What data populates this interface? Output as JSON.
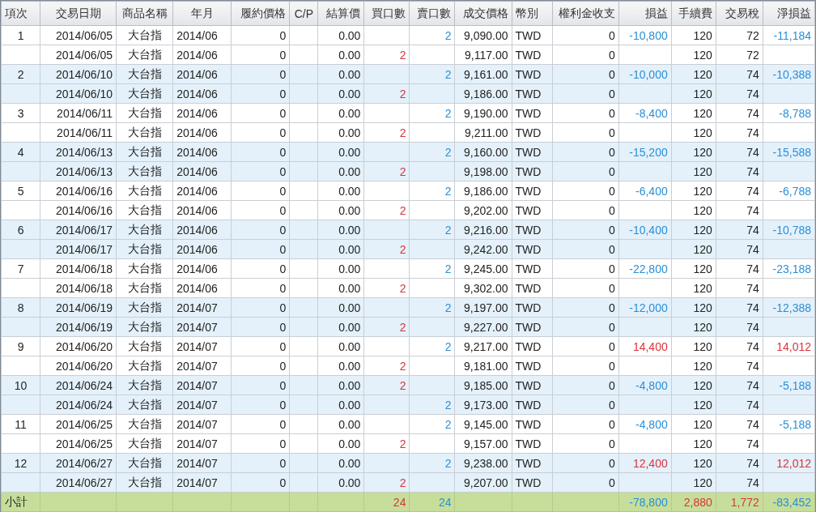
{
  "table": {
    "columns": [
      "項次",
      "交易日期",
      "商品名稱",
      "年月",
      "履約價格",
      "C/P",
      "結算價",
      "買口數",
      "賣口數",
      "成交價格",
      "幣別",
      "權利金收支",
      "損益",
      "手續費",
      "交易稅",
      "淨損益"
    ],
    "rows": [
      {
        "no": "1",
        "date": "2014/06/05",
        "product": "大台指",
        "month": "2014/06",
        "strike": "0",
        "settle": "0.00",
        "sell": "2",
        "price": "9,090.00",
        "currency": "TWD",
        "premium": "0",
        "pnl": "-10,800",
        "fee": "120",
        "tax": "72",
        "net": "-11,184",
        "gain": false
      },
      {
        "date": "2014/06/05",
        "product": "大台指",
        "month": "2014/06",
        "strike": "0",
        "settle": "0.00",
        "buy": "2",
        "price": "9,117.00",
        "currency": "TWD",
        "premium": "0",
        "fee": "120",
        "tax": "72"
      },
      {
        "no": "2",
        "date": "2014/06/10",
        "product": "大台指",
        "month": "2014/06",
        "strike": "0",
        "settle": "0.00",
        "sell": "2",
        "price": "9,161.00",
        "currency": "TWD",
        "premium": "0",
        "pnl": "-10,000",
        "fee": "120",
        "tax": "74",
        "net": "-10,388",
        "gain": false
      },
      {
        "date": "2014/06/10",
        "product": "大台指",
        "month": "2014/06",
        "strike": "0",
        "settle": "0.00",
        "buy": "2",
        "price": "9,186.00",
        "currency": "TWD",
        "premium": "0",
        "fee": "120",
        "tax": "74"
      },
      {
        "no": "3",
        "date": "2014/06/11",
        "product": "大台指",
        "month": "2014/06",
        "strike": "0",
        "settle": "0.00",
        "sell": "2",
        "price": "9,190.00",
        "currency": "TWD",
        "premium": "0",
        "pnl": "-8,400",
        "fee": "120",
        "tax": "74",
        "net": "-8,788",
        "gain": false
      },
      {
        "date": "2014/06/11",
        "product": "大台指",
        "month": "2014/06",
        "strike": "0",
        "settle": "0.00",
        "buy": "2",
        "price": "9,211.00",
        "currency": "TWD",
        "premium": "0",
        "fee": "120",
        "tax": "74"
      },
      {
        "no": "4",
        "date": "2014/06/13",
        "product": "大台指",
        "month": "2014/06",
        "strike": "0",
        "settle": "0.00",
        "sell": "2",
        "price": "9,160.00",
        "currency": "TWD",
        "premium": "0",
        "pnl": "-15,200",
        "fee": "120",
        "tax": "74",
        "net": "-15,588",
        "gain": false
      },
      {
        "date": "2014/06/13",
        "product": "大台指",
        "month": "2014/06",
        "strike": "0",
        "settle": "0.00",
        "buy": "2",
        "price": "9,198.00",
        "currency": "TWD",
        "premium": "0",
        "fee": "120",
        "tax": "74"
      },
      {
        "no": "5",
        "date": "2014/06/16",
        "product": "大台指",
        "month": "2014/06",
        "strike": "0",
        "settle": "0.00",
        "sell": "2",
        "price": "9,186.00",
        "currency": "TWD",
        "premium": "0",
        "pnl": "-6,400",
        "fee": "120",
        "tax": "74",
        "net": "-6,788",
        "gain": false
      },
      {
        "date": "2014/06/16",
        "product": "大台指",
        "month": "2014/06",
        "strike": "0",
        "settle": "0.00",
        "buy": "2",
        "price": "9,202.00",
        "currency": "TWD",
        "premium": "0",
        "fee": "120",
        "tax": "74"
      },
      {
        "no": "6",
        "date": "2014/06/17",
        "product": "大台指",
        "month": "2014/06",
        "strike": "0",
        "settle": "0.00",
        "sell": "2",
        "price": "9,216.00",
        "currency": "TWD",
        "premium": "0",
        "pnl": "-10,400",
        "fee": "120",
        "tax": "74",
        "net": "-10,788",
        "gain": false
      },
      {
        "date": "2014/06/17",
        "product": "大台指",
        "month": "2014/06",
        "strike": "0",
        "settle": "0.00",
        "buy": "2",
        "price": "9,242.00",
        "currency": "TWD",
        "premium": "0",
        "fee": "120",
        "tax": "74"
      },
      {
        "no": "7",
        "date": "2014/06/18",
        "product": "大台指",
        "month": "2014/06",
        "strike": "0",
        "settle": "0.00",
        "sell": "2",
        "price": "9,245.00",
        "currency": "TWD",
        "premium": "0",
        "pnl": "-22,800",
        "fee": "120",
        "tax": "74",
        "net": "-23,188",
        "gain": false
      },
      {
        "date": "2014/06/18",
        "product": "大台指",
        "month": "2014/06",
        "strike": "0",
        "settle": "0.00",
        "buy": "2",
        "price": "9,302.00",
        "currency": "TWD",
        "premium": "0",
        "fee": "120",
        "tax": "74"
      },
      {
        "no": "8",
        "date": "2014/06/19",
        "product": "大台指",
        "month": "2014/07",
        "strike": "0",
        "settle": "0.00",
        "sell": "2",
        "price": "9,197.00",
        "currency": "TWD",
        "premium": "0",
        "pnl": "-12,000",
        "fee": "120",
        "tax": "74",
        "net": "-12,388",
        "gain": false
      },
      {
        "date": "2014/06/19",
        "product": "大台指",
        "month": "2014/07",
        "strike": "0",
        "settle": "0.00",
        "buy": "2",
        "price": "9,227.00",
        "currency": "TWD",
        "premium": "0",
        "fee": "120",
        "tax": "74"
      },
      {
        "no": "9",
        "date": "2014/06/20",
        "product": "大台指",
        "month": "2014/07",
        "strike": "0",
        "settle": "0.00",
        "sell": "2",
        "price": "9,217.00",
        "currency": "TWD",
        "premium": "0",
        "pnl": "14,400",
        "fee": "120",
        "tax": "74",
        "net": "14,012",
        "gain": true
      },
      {
        "date": "2014/06/20",
        "product": "大台指",
        "month": "2014/07",
        "strike": "0",
        "settle": "0.00",
        "buy": "2",
        "price": "9,181.00",
        "currency": "TWD",
        "premium": "0",
        "fee": "120",
        "tax": "74"
      },
      {
        "no": "10",
        "date": "2014/06/24",
        "product": "大台指",
        "month": "2014/07",
        "strike": "0",
        "settle": "0.00",
        "buy": "2",
        "price": "9,185.00",
        "currency": "TWD",
        "premium": "0",
        "pnl": "-4,800",
        "fee": "120",
        "tax": "74",
        "net": "-5,188",
        "gain": false
      },
      {
        "date": "2014/06/24",
        "product": "大台指",
        "month": "2014/07",
        "strike": "0",
        "settle": "0.00",
        "sell": "2",
        "price": "9,173.00",
        "currency": "TWD",
        "premium": "0",
        "fee": "120",
        "tax": "74"
      },
      {
        "no": "11",
        "date": "2014/06/25",
        "product": "大台指",
        "month": "2014/07",
        "strike": "0",
        "settle": "0.00",
        "sell": "2",
        "price": "9,145.00",
        "currency": "TWD",
        "premium": "0",
        "pnl": "-4,800",
        "fee": "120",
        "tax": "74",
        "net": "-5,188",
        "gain": false
      },
      {
        "date": "2014/06/25",
        "product": "大台指",
        "month": "2014/07",
        "strike": "0",
        "settle": "0.00",
        "buy": "2",
        "price": "9,157.00",
        "currency": "TWD",
        "premium": "0",
        "fee": "120",
        "tax": "74"
      },
      {
        "no": "12",
        "date": "2014/06/27",
        "product": "大台指",
        "month": "2014/07",
        "strike": "0",
        "settle": "0.00",
        "sell": "2",
        "price": "9,238.00",
        "currency": "TWD",
        "premium": "0",
        "pnl": "12,400",
        "fee": "120",
        "tax": "74",
        "net": "12,012",
        "gain": true
      },
      {
        "date": "2014/06/27",
        "product": "大台指",
        "month": "2014/07",
        "strike": "0",
        "settle": "0.00",
        "buy": "2",
        "price": "9,207.00",
        "currency": "TWD",
        "premium": "0",
        "fee": "120",
        "tax": "74"
      }
    ],
    "footer": {
      "no": "小計",
      "buy": "24",
      "sell": "24",
      "pnl": {
        "text": "-78,800",
        "color": "#2a8fd6"
      },
      "fee": {
        "text": "2,880",
        "color": "#d8343c"
      },
      "tax": {
        "text": "1,772",
        "color": "#d8343c"
      },
      "net": {
        "text": "-83,452",
        "color": "#2a8fd6"
      }
    }
  }
}
